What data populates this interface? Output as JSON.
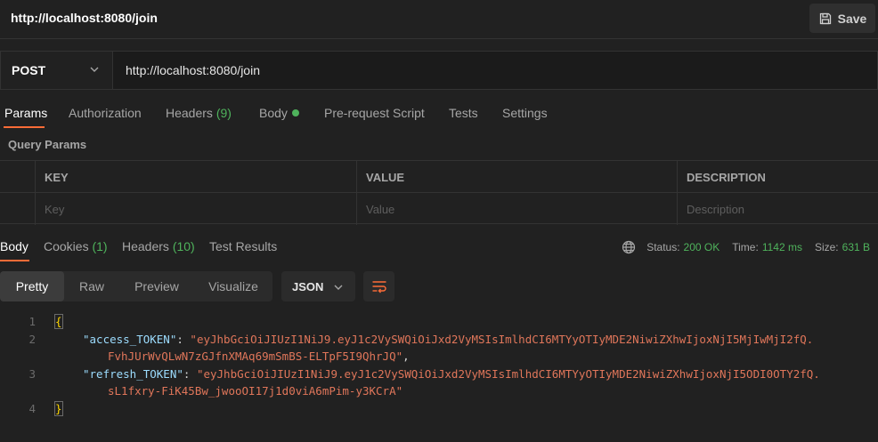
{
  "titlebar": {
    "title": "http://localhost:8080/join",
    "save_label": "Save"
  },
  "request": {
    "method": "POST",
    "url": "http://localhost:8080/join"
  },
  "request_tabs": {
    "params": "Params",
    "authorization": "Authorization",
    "headers": "Headers",
    "headers_count": "(9)",
    "body": "Body",
    "prerequest": "Pre-request Script",
    "tests": "Tests",
    "settings": "Settings"
  },
  "query_params": {
    "label": "Query Params",
    "columns": [
      "KEY",
      "VALUE",
      "DESCRIPTION"
    ],
    "placeholders": [
      "Key",
      "Value",
      "Description"
    ]
  },
  "response_tabs": {
    "body": "Body",
    "cookies": "Cookies",
    "cookies_count": "(1)",
    "headers": "Headers",
    "headers_count": "(10)",
    "test_results": "Test Results"
  },
  "status": {
    "status_label": "Status:",
    "status_value": "200 OK",
    "time_label": "Time:",
    "time_value": "1142 ms",
    "size_label": "Size:",
    "size_value": "631 B"
  },
  "view": {
    "pretty": "Pretty",
    "raw": "Raw",
    "preview": "Preview",
    "visualize": "Visualize",
    "format": "JSON"
  },
  "code": {
    "line_numbers": [
      "1",
      "2",
      "3",
      "4"
    ],
    "open_brace": "{",
    "close_brace": "}",
    "access_key": "\"access_TOKEN\"",
    "access_value_1": "\"eyJhbGciOiJIUzI1NiJ9.eyJ1c2VySWQiOiJxd2VyMSIsImlhdCI6MTYyOTIyMDE2NiwiZXhwIjoxNjI5MjIwMjI2fQ.",
    "access_value_2": "FvhJUrWvQLwN7zGJfnXMAq69mSmBS-ELTpF5I9QhrJQ\"",
    "refresh_key": "\"refresh_TOKEN\"",
    "refresh_value_1": "\"eyJhbGciOiJIUzI1NiJ9.eyJ1c2VySWQiOiJxd2VyMSIsImlhdCI6MTYyOTIyMDE2NiwiZXhwIjoxNjI5ODI0OTY2fQ.",
    "refresh_value_2": "sL1fxry-FiK45Bw_jwooOI17j1d0viA6mPim-y3KCrA\""
  },
  "colors": {
    "accent": "#ff6c37",
    "success": "#4fb35c",
    "background": "#212121"
  }
}
